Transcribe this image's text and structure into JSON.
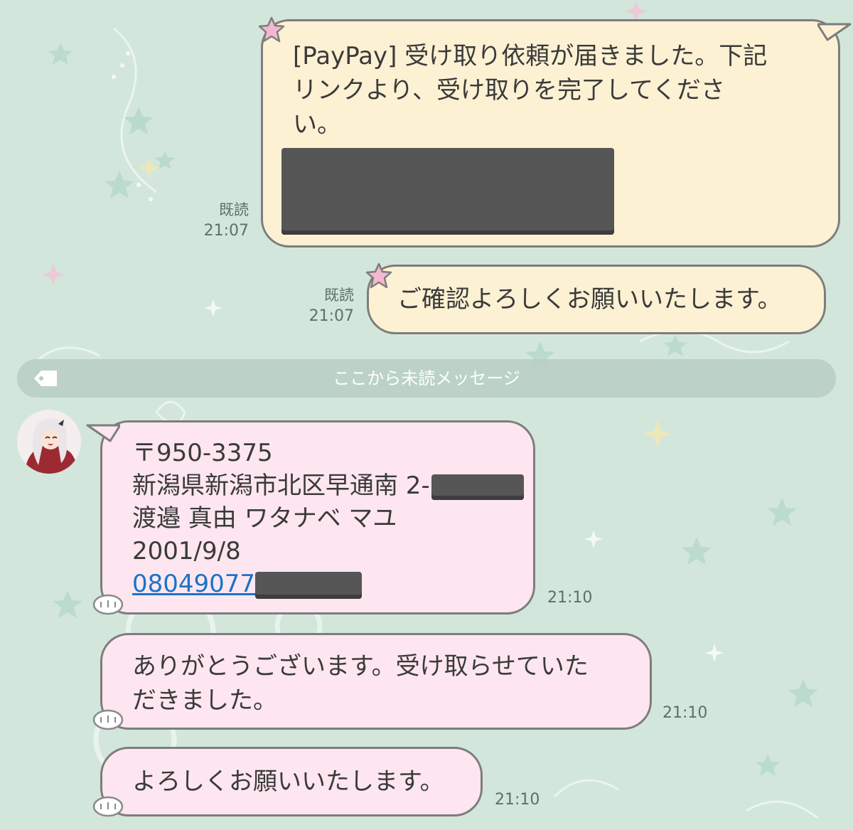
{
  "messages": [
    {
      "id": "out1",
      "direction": "outgoing",
      "lines": [
        "[PayPay] 受け取り依頼が届きました。下記",
        "リンクより、受け取りを完了してくださ",
        "い。"
      ],
      "read_label": "既読",
      "time": "21:07"
    },
    {
      "id": "out2",
      "direction": "outgoing",
      "text": "ご確認よろしくお願いいたします。",
      "read_label": "既読",
      "time": "21:07"
    },
    {
      "id": "in1",
      "direction": "incoming",
      "lines": [
        "〒950-3375",
        "新潟県新潟市北区早通南 2-",
        "渡邉 真由 ワタナベ マユ",
        "2001/9/8"
      ],
      "phone_link": "08049077",
      "time": "21:10"
    },
    {
      "id": "in2",
      "direction": "incoming",
      "lines": [
        "ありがとうございます。受け取らせていた",
        "だきました。"
      ],
      "time": "21:10"
    },
    {
      "id": "in3",
      "direction": "incoming",
      "text": "よろしくお願いいたします。",
      "time": "21:10"
    }
  ],
  "unread_divider": "ここから未読メッセージ",
  "icons": {
    "unread_tag": "tag-icon",
    "bubble_decoration": "star-icon",
    "avatar": "avatar"
  },
  "colors": {
    "background": "#d3e6dc",
    "outgoing_bubble": "#fdf1d3",
    "incoming_bubble": "#fde6ef",
    "bubble_border": "#7d7d7d",
    "link": "#1a73c9",
    "redaction": "#565656"
  }
}
